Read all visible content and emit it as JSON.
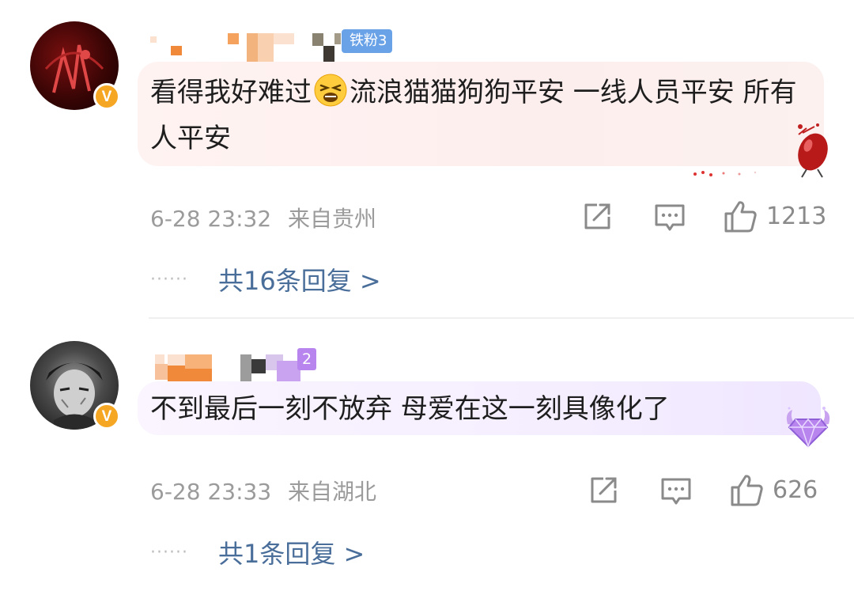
{
  "comments": [
    {
      "fan_badge": "铁粉3",
      "text_part1": "看得我好难过",
      "text_part2": "流浪猫猫狗狗平安 一线人员平安 所有人平安",
      "timestamp": "6-28 23:32",
      "location": "来自贵州",
      "likes": "1213",
      "replies": "共16条回复 >",
      "verified_badge": "V"
    },
    {
      "level_badge": "2",
      "text": "不到最后一刻不放弃 母爱在这一刻具像化了",
      "timestamp": "6-28 23:33",
      "location": "来自湖北",
      "likes": "626",
      "replies": "共1条回复 >",
      "verified_badge": "V"
    }
  ],
  "icons": [
    "share-icon",
    "comment-icon",
    "like-icon",
    "emoji-weary-icon",
    "vip-diamond-icon"
  ],
  "colors": {
    "verified": "#f5a623",
    "reply_link": "#4a6e9a",
    "fan_badge": "#6aa2e8",
    "level_badge": "#b885ee"
  }
}
